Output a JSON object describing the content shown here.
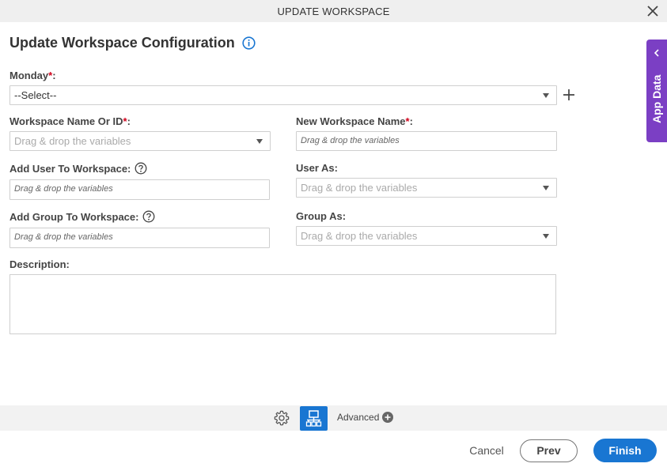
{
  "dialog": {
    "title": "UPDATE WORKSPACE",
    "heading": "Update Workspace Configuration"
  },
  "form": {
    "monday": {
      "label": "Monday",
      "required": "*",
      "suffix": ":",
      "value": "--Select--"
    },
    "workspace_name_or_id": {
      "label": "Workspace Name Or ID",
      "required": "*",
      "suffix": ":",
      "placeholder": "Drag & drop the variables"
    },
    "new_workspace_name": {
      "label": "New Workspace Name",
      "required": "*",
      "suffix": ":",
      "placeholder": "Drag & drop the variables"
    },
    "add_user_to_workspace": {
      "label": "Add User To Workspace:",
      "placeholder": "Drag & drop the variables"
    },
    "user_as": {
      "label": "User As:",
      "placeholder": "Drag & drop the variables"
    },
    "add_group_to_workspace": {
      "label": "Add Group To Workspace:",
      "placeholder": "Drag & drop the variables"
    },
    "group_as": {
      "label": "Group As:",
      "placeholder": "Drag & drop the variables"
    },
    "description": {
      "label": "Description:",
      "value": ""
    }
  },
  "side_panel": {
    "label": "App Data"
  },
  "toolbar": {
    "advanced_label": "Advanced"
  },
  "footer": {
    "cancel": "Cancel",
    "prev": "Prev",
    "finish": "Finish"
  },
  "colors": {
    "primary": "#1976d2",
    "app_data": "#7b3fc4",
    "required": "#d0021b"
  },
  "icons": [
    "close-icon",
    "info-icon",
    "help-icon",
    "plus-icon",
    "chevron-left-icon",
    "gear-icon",
    "data-mapping-icon",
    "add-circle-icon"
  ]
}
